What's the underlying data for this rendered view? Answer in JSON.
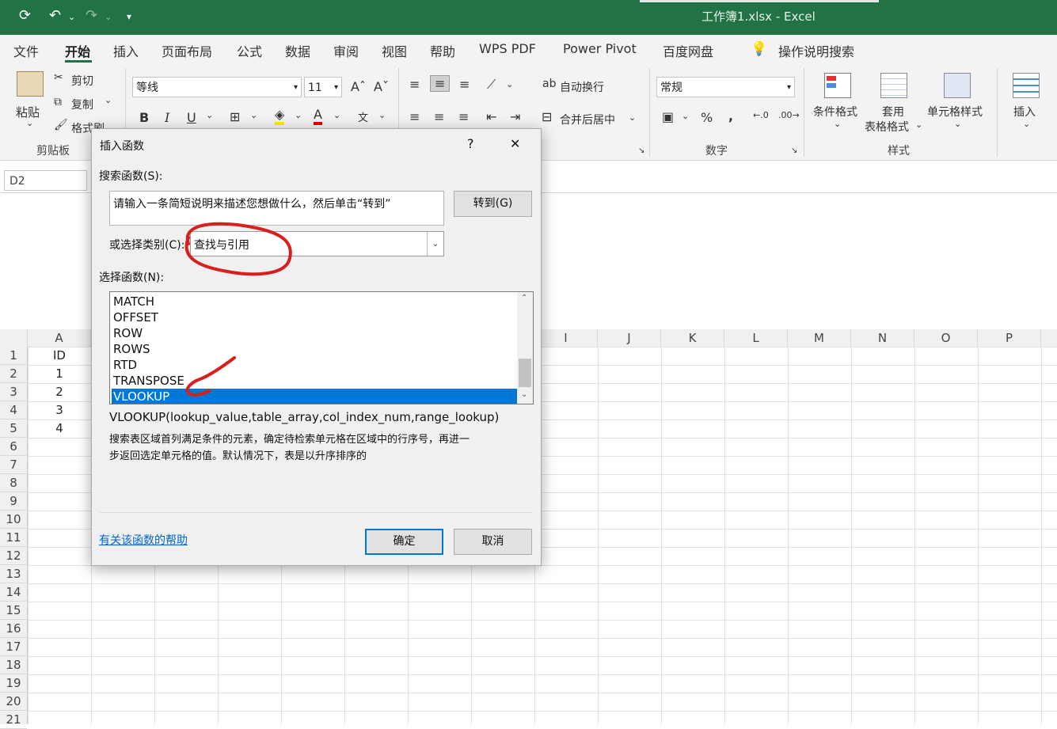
{
  "window": {
    "title": "工作簿1.xlsx  -  Excel"
  },
  "menu_tabs": [
    "文件",
    "开始",
    "插入",
    "页面布局",
    "公式",
    "数据",
    "审阅",
    "视图",
    "帮助",
    "WPS PDF",
    "Power Pivot",
    "百度网盘"
  ],
  "tell_me": "操作说明搜索",
  "ribbon": {
    "paste": "粘贴",
    "cut": "剪切",
    "copy": "复制",
    "format_painter": "格式刷",
    "clipboard_group": "剪贴板",
    "font_name": "等线",
    "font_size": "11",
    "bold": "B",
    "italic": "I",
    "underline": "U",
    "wrap_text": "自动换行",
    "merge_center": "合并后居中",
    "number_format": "常规",
    "number_group": "数字",
    "percent": "%",
    "comma": ",",
    "conditional_format": "条件格式",
    "format_as_table_1": "套用",
    "format_as_table_2": "表格格式",
    "cell_styles": "单元格样式",
    "styles_group": "样式",
    "insert": "插入"
  },
  "name_box": "D2",
  "columns": [
    "A",
    "I",
    "J",
    "K",
    "L",
    "M",
    "N",
    "O",
    "P"
  ],
  "rows": [
    "1",
    "2",
    "3",
    "4",
    "5",
    "6",
    "7",
    "8",
    "9",
    "10",
    "11",
    "12",
    "13",
    "14",
    "15",
    "16",
    "17",
    "18",
    "19",
    "20",
    "21"
  ],
  "cells": {
    "A1": "ID",
    "A2": "1",
    "A3": "2",
    "A4": "3",
    "A5": "4"
  },
  "dialog": {
    "title": "插入函数",
    "help_q": "?",
    "close": "✕",
    "search_label": "搜索函数(S):",
    "search_value": "请输入一条简短说明来描述您想做什么，然后单击“转到”",
    "go_button": "转到(G)",
    "category_label": "或选择类别(C):",
    "category_value": "查找与引用",
    "function_label": "选择函数(N):",
    "functions": [
      "MATCH",
      "OFFSET",
      "ROW",
      "ROWS",
      "RTD",
      "TRANSPOSE",
      "VLOOKUP"
    ],
    "selected_function": "VLOOKUP",
    "signature": "VLOOKUP(lookup_value,table_array,col_index_num,range_lookup)",
    "desc_line1": "搜索表区域首列满足条件的元素，确定待检索单元格在区域中的行序号，再进一",
    "desc_line2": "步返回选定单元格的值。默认情况下，表是以升序排序的",
    "help_link": "有关该函数的帮助",
    "ok": "确定",
    "cancel": "取消"
  },
  "colors": {
    "excel_green": "#217346",
    "selection_blue": "#0078d7",
    "annotation_red": "#d81e1e"
  }
}
